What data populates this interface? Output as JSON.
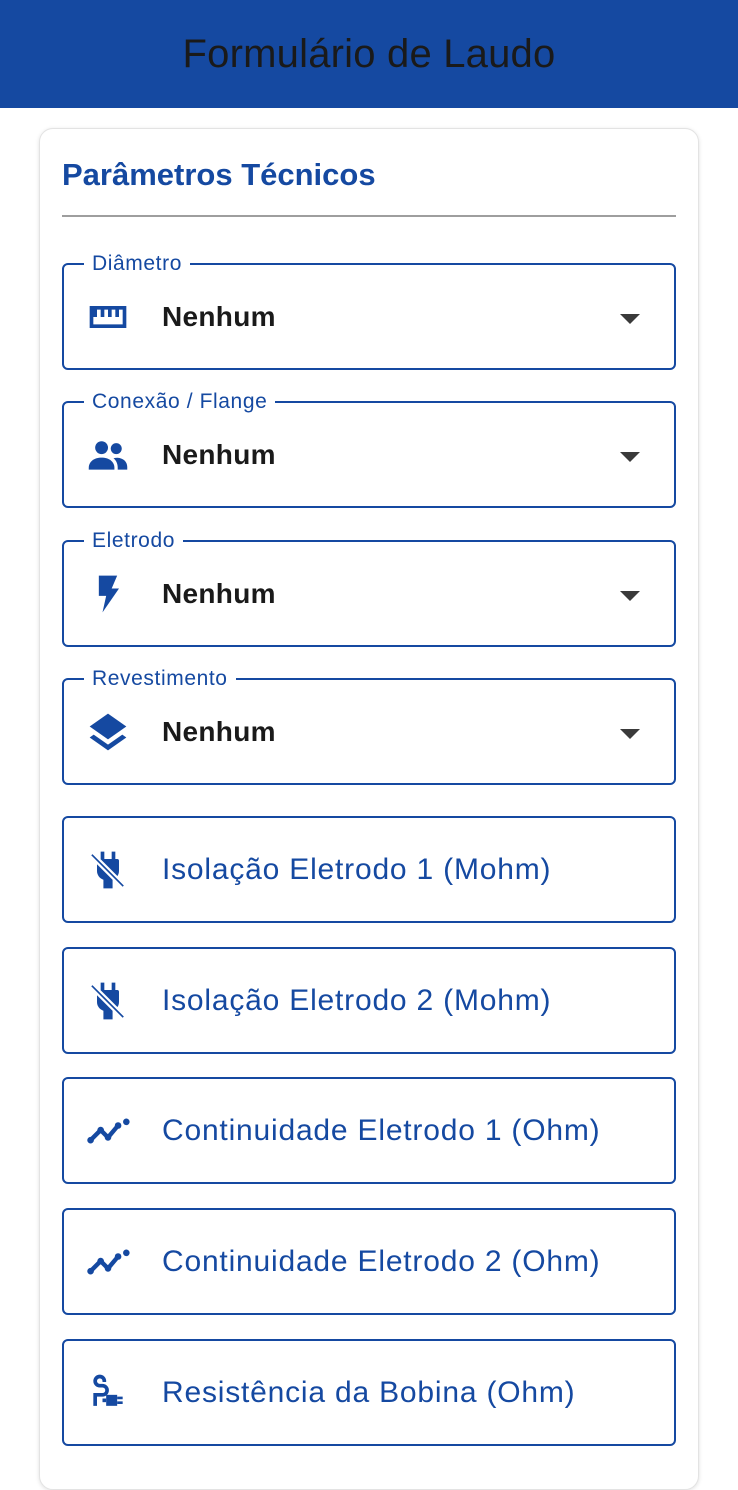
{
  "header": {
    "title": "Formulário de Laudo"
  },
  "section": {
    "title": "Parâmetros Técnicos"
  },
  "selects": [
    {
      "label": "Diâmetro",
      "value": "Nenhum",
      "icon": "ruler-icon"
    },
    {
      "label": "Conexão / Flange",
      "value": "Nenhum",
      "icon": "people-icon"
    },
    {
      "label": "Eletrodo",
      "value": "Nenhum",
      "icon": "bolt-icon"
    },
    {
      "label": "Revestimento",
      "value": "Nenhum",
      "icon": "layers-icon"
    }
  ],
  "inputs": [
    {
      "label": "Isolação Eletrodo 1 (Mohm)",
      "icon": "power-off-icon"
    },
    {
      "label": "Isolação Eletrodo 2 (Mohm)",
      "icon": "power-off-icon"
    },
    {
      "label": "Continuidade Eletrodo 1 (Ohm)",
      "icon": "line-chart-icon"
    },
    {
      "label": "Continuidade Eletrodo 2 (Ohm)",
      "icon": "line-chart-icon"
    },
    {
      "label": "Resistência da Bobina (Ohm)",
      "icon": "cable-icon"
    }
  ],
  "colors": {
    "primary": "#1549a1",
    "text": "#1a1a1a"
  }
}
